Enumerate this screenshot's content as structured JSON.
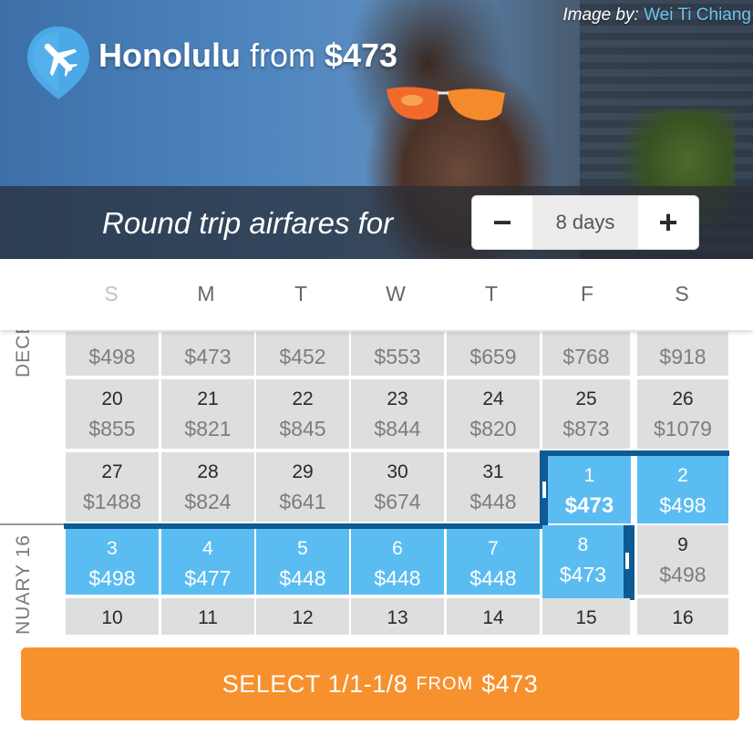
{
  "hero": {
    "image_credit_prefix": "Image by:",
    "image_credit_author": "Wei Ti Chiang",
    "destination": "Honolulu",
    "from_word": "from",
    "from_price": "$473",
    "pin_icon": "airplane-icon",
    "fare_label": "Round trip airfares for",
    "trip_length": "8 days",
    "decrement_symbol": "−",
    "increment_symbol": "+"
  },
  "weekdays": [
    "S",
    "M",
    "T",
    "W",
    "T",
    "F",
    "S"
  ],
  "months": {
    "december": "DECE",
    "january": "NUARY 16"
  },
  "weeks": [
    [
      {
        "day": "",
        "fare": "$498"
      },
      {
        "day": "",
        "fare": "$473"
      },
      {
        "day": "",
        "fare": "$452"
      },
      {
        "day": "",
        "fare": "$553"
      },
      {
        "day": "",
        "fare": "$659"
      },
      {
        "day": "",
        "fare": "$768"
      },
      {
        "day": "",
        "fare": "$918"
      }
    ],
    [
      {
        "day": "20",
        "fare": "$855"
      },
      {
        "day": "21",
        "fare": "$821"
      },
      {
        "day": "22",
        "fare": "$845"
      },
      {
        "day": "23",
        "fare": "$844"
      },
      {
        "day": "24",
        "fare": "$820"
      },
      {
        "day": "25",
        "fare": "$873"
      },
      {
        "day": "26",
        "fare": "$1079"
      }
    ],
    [
      {
        "day": "27",
        "fare": "$1488"
      },
      {
        "day": "28",
        "fare": "$824"
      },
      {
        "day": "29",
        "fare": "$641"
      },
      {
        "day": "30",
        "fare": "$674"
      },
      {
        "day": "31",
        "fare": "$448"
      },
      {
        "day": "1",
        "fare": "$473"
      },
      {
        "day": "2",
        "fare": "$498"
      }
    ],
    [
      {
        "day": "3",
        "fare": "$498"
      },
      {
        "day": "4",
        "fare": "$477"
      },
      {
        "day": "5",
        "fare": "$448"
      },
      {
        "day": "6",
        "fare": "$448"
      },
      {
        "day": "7",
        "fare": "$448"
      },
      {
        "day": "8",
        "fare": "$473"
      },
      {
        "day": "9",
        "fare": "$498"
      }
    ],
    [
      {
        "day": "10",
        "fare": ""
      },
      {
        "day": "11",
        "fare": ""
      },
      {
        "day": "12",
        "fare": ""
      },
      {
        "day": "13",
        "fare": ""
      },
      {
        "day": "14",
        "fare": ""
      },
      {
        "day": "15",
        "fare": ""
      },
      {
        "day": "16",
        "fare": ""
      }
    ]
  ],
  "selection": {
    "start_label": "1",
    "end_label": "8",
    "color": "#5bbcf2",
    "border_color": "#0d5a95"
  },
  "footer": {
    "select_word": "SELECT",
    "range": "1/1-1/8",
    "from_word": "FROM",
    "price": "$473",
    "button_color": "#f7912e"
  }
}
